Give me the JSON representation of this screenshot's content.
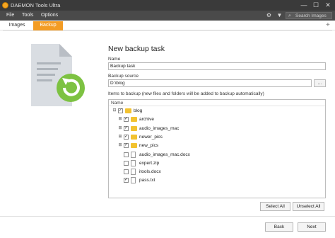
{
  "window": {
    "title": "DAEMON Tools Ultra",
    "controls": {
      "minimize": "—",
      "maximize": "☐",
      "close": "✕"
    }
  },
  "menubar": {
    "items": [
      "File",
      "Tools",
      "Options"
    ],
    "search_placeholder": "Search Images"
  },
  "tabs": [
    {
      "label": "Images",
      "active": false
    },
    {
      "label": "Backup",
      "active": true
    }
  ],
  "add_tab": "+",
  "form": {
    "heading": "New backup task",
    "name_label": "Name",
    "name_value": "Backup task",
    "source_label": "Backup source",
    "source_value": "D:\\blog",
    "browse_label": "...",
    "items_label": "Items to backup (new files and folders will be added to backup automatically)",
    "tree_header": "Name",
    "tree": [
      {
        "label": "blog",
        "type": "folder",
        "checked": true,
        "expander": "⊟",
        "level": 0
      },
      {
        "label": "archive",
        "type": "folder",
        "checked": true,
        "expander": "⊞",
        "level": 1
      },
      {
        "label": "audio_images_mac",
        "type": "folder",
        "checked": true,
        "expander": "⊞",
        "level": 1
      },
      {
        "label": "newer_pics",
        "type": "folder",
        "checked": true,
        "expander": "⊞",
        "level": 1
      },
      {
        "label": "new_pics",
        "type": "folder",
        "checked": true,
        "expander": "⊞",
        "level": 1
      },
      {
        "label": "audio_images_mac.docx",
        "type": "file",
        "checked": false,
        "expander": "",
        "level": 1
      },
      {
        "label": "expert.zip",
        "type": "file",
        "checked": false,
        "expander": "",
        "level": 1
      },
      {
        "label": "itools.docx",
        "type": "file",
        "checked": false,
        "expander": "",
        "level": 1
      },
      {
        "label": "pass.txt",
        "type": "file",
        "checked": true,
        "expander": "",
        "level": 1
      }
    ],
    "select_all": "Select All",
    "unselect_all": "Unselect All"
  },
  "footer": {
    "back": "Back",
    "next": "Next"
  },
  "colors": {
    "accent": "#f39c24",
    "titlebar": "#3a3a3a",
    "menubar": "#4a4a4a",
    "restore_arrow": "#7dc242",
    "folder": "#f2c230"
  }
}
